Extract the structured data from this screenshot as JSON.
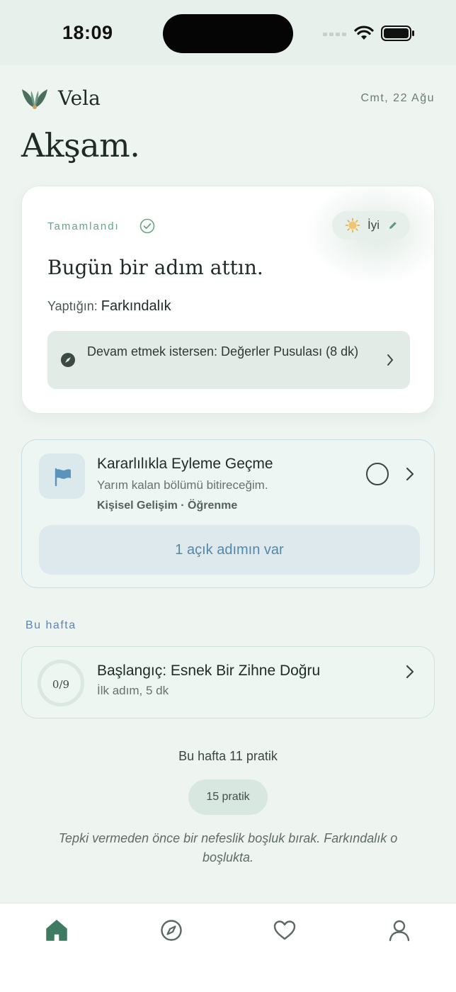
{
  "status_bar": {
    "time": "18:09",
    "icons": [
      "signal-icon",
      "wifi-icon",
      "battery-icon"
    ]
  },
  "header": {
    "brand": "Vela",
    "date": "Cmt, 22 Ağu",
    "greeting": "Akşam."
  },
  "today_card": {
    "status_label": "Tamamlandı",
    "mood_label": "İyi",
    "headline": "Bugün bir adım attın.",
    "did_prefix": "Yaptığın:",
    "did_value": "Farkındalık",
    "continue_text": "Devam etmek istersen: Değerler Pusulası (8 dk)"
  },
  "goal_card": {
    "title": "Kararlılıkla Eyleme Geçme",
    "subtitle": "Yarım kalan bölümü bitireceğim.",
    "tags": "Kişisel Gelişim · Öğrenme",
    "open_steps_label": "1 açık adımın var"
  },
  "this_week": {
    "section_label": "Bu hafta",
    "program_progress": "0/9",
    "program_title": "Başlangıç: Esnek Bir Zihne Doğru",
    "program_subtitle": "İlk adım, 5 dk",
    "week_count": "Bu hafta 11 pratik",
    "practice_pill": "15 pratik"
  },
  "quote": "Tepki vermeden önce bir nefeslik boşluk bırak. Farkındalık o boşlukta.",
  "tabbar": {
    "active": "home",
    "tabs": [
      "home",
      "explore",
      "favorites",
      "profile"
    ]
  },
  "colors": {
    "accent_green": "#3f7a63",
    "completed_green": "#66a585",
    "blue_accent": "#5289a8",
    "background": "#eef5f1"
  }
}
